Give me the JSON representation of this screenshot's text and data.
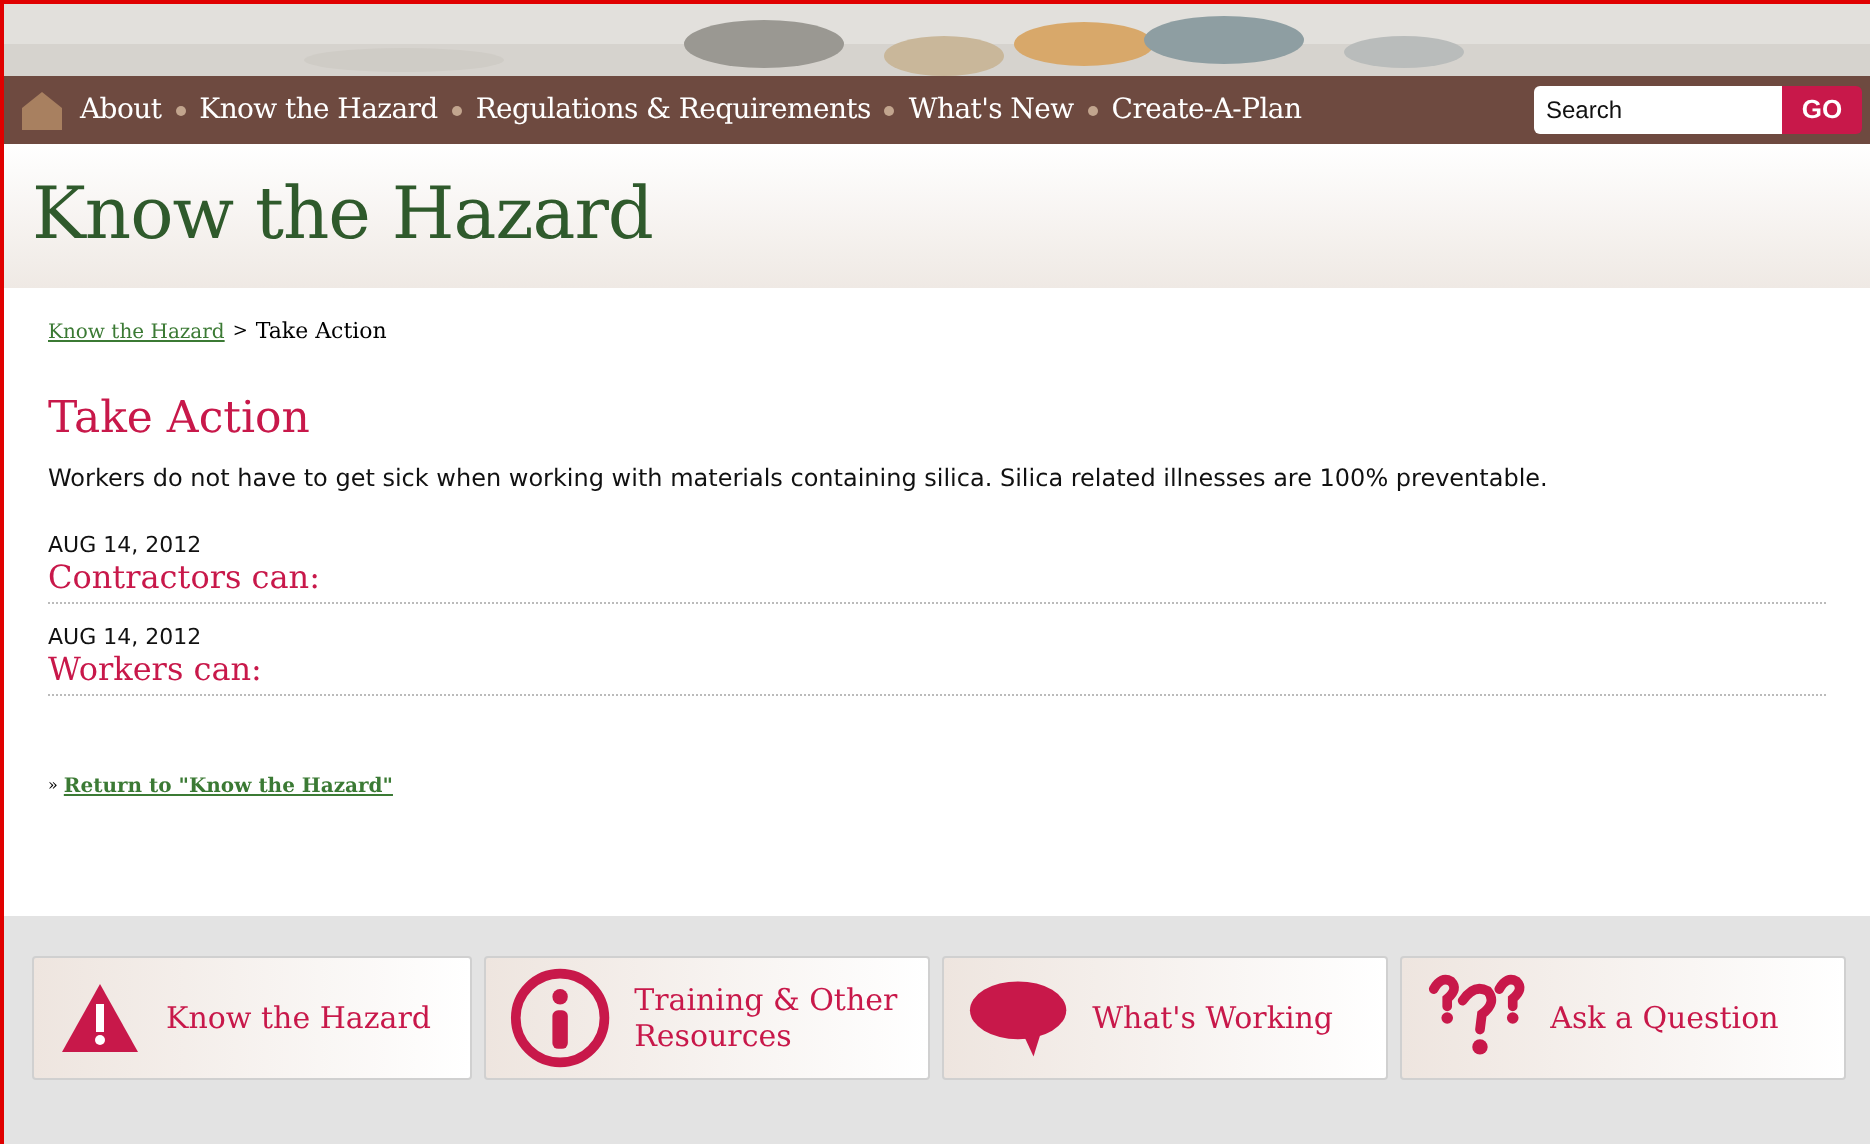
{
  "nav": {
    "items": [
      {
        "label": "About"
      },
      {
        "label": "Know the Hazard"
      },
      {
        "label": "Regulations & Requirements"
      },
      {
        "label": "What's New"
      },
      {
        "label": "Create-A-Plan"
      }
    ],
    "search": {
      "placeholder": "Search",
      "button": "GO"
    }
  },
  "banner": {
    "title": "Know the Hazard"
  },
  "breadcrumb": {
    "link": "Know the Hazard",
    "separator": ">",
    "current": "Take Action"
  },
  "heading": "Take Action",
  "intro": "Workers do not have to get sick when working with materials containing silica. Silica related illnesses are 100% preventable.",
  "entries": [
    {
      "date": "AUG 14, 2012",
      "title": "Contractors can:"
    },
    {
      "date": "AUG 14, 2012",
      "title": "Workers can:"
    }
  ],
  "return_link": {
    "bullet": "»",
    "label": "Return to \"Know the Hazard\""
  },
  "quick_links": [
    {
      "kind": "warning",
      "label": "Know the Hazard"
    },
    {
      "kind": "info",
      "label": "Training & Other Resources"
    },
    {
      "kind": "speech",
      "label": "What's Working"
    },
    {
      "kind": "question",
      "label": "Ask a Question"
    }
  ]
}
